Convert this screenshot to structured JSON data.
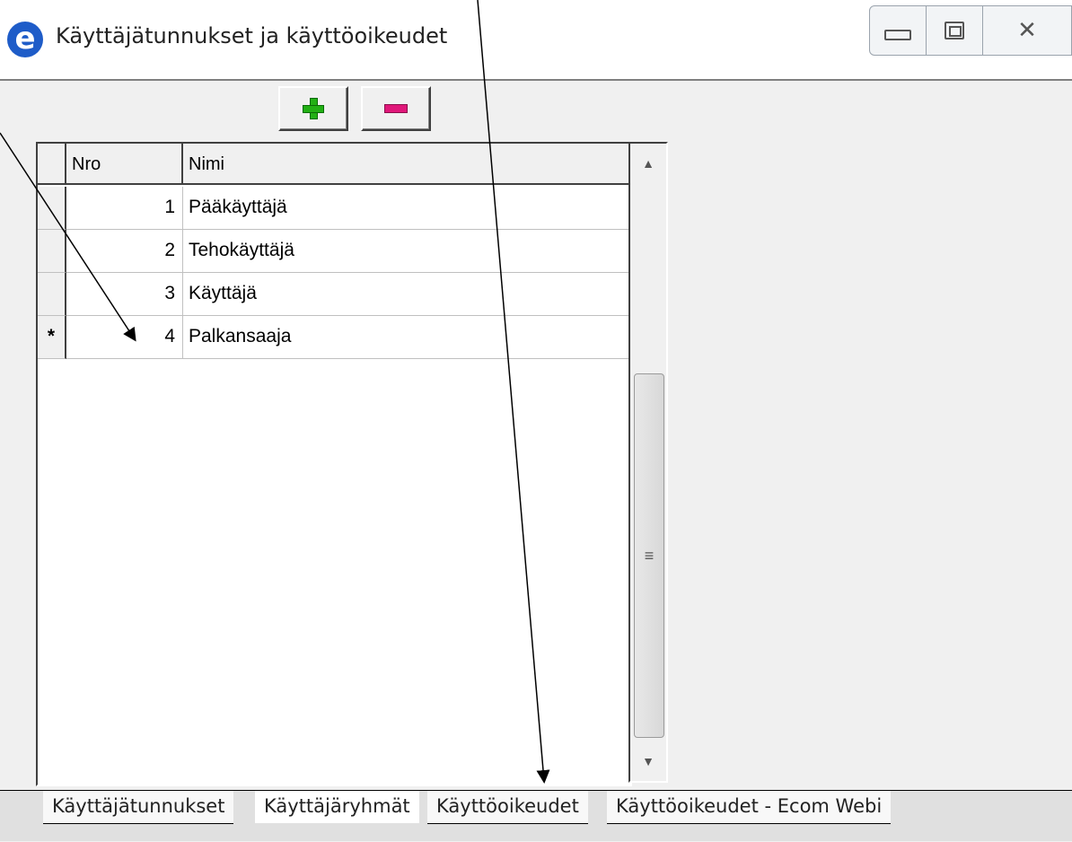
{
  "window": {
    "title": "Käyttäjätunnukset ja käyttöoikeudet",
    "icon": "e-app-icon"
  },
  "toolbar": {
    "add_icon": "plus-icon",
    "remove_icon": "minus-icon"
  },
  "grid": {
    "columns": [
      "Nro",
      "Nimi"
    ],
    "rows": [
      {
        "marker": "",
        "nro": "1",
        "nimi": "Pääkäyttäjä"
      },
      {
        "marker": "",
        "nro": "2",
        "nimi": "Tehokäyttäjä"
      },
      {
        "marker": "",
        "nro": "3",
        "nimi": "Käyttäjä"
      },
      {
        "marker": "*",
        "nro": "4",
        "nimi": "Palkansaaja"
      }
    ]
  },
  "tabs": [
    {
      "label": "Käyttäjätunnukset",
      "active": false
    },
    {
      "label": "Käyttäjäryhmät",
      "active": true
    },
    {
      "label": "Käyttöoikeudet",
      "active": false
    },
    {
      "label": "Käyttöoikeudet - Ecom Webi",
      "active": false
    }
  ],
  "colors": {
    "plus": "#22b014",
    "minus": "#e0177a",
    "title_icon": "#1e5cc8"
  }
}
